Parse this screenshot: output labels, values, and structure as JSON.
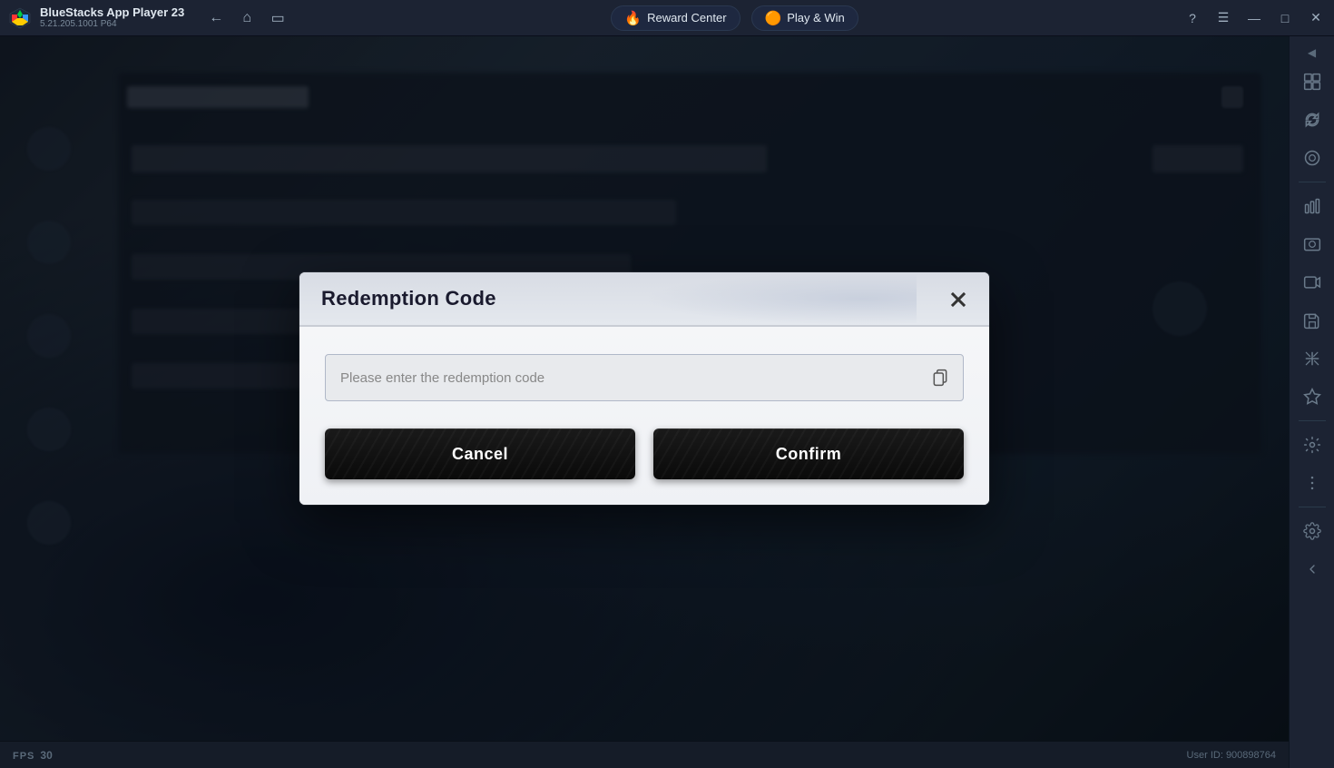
{
  "titlebar": {
    "app_name": "BlueStacks App Player 23",
    "app_version": "5.21.205.1001 P64",
    "reward_center_label": "Reward Center",
    "play_win_label": "Play & Win"
  },
  "window_controls": {
    "help": "?",
    "menu": "≡",
    "minimize": "—",
    "maximize": "□",
    "close": "✕"
  },
  "modal": {
    "title": "Redemption Code",
    "input_placeholder": "Please enter the redemption code",
    "cancel_label": "Cancel",
    "confirm_label": "Confirm"
  },
  "statusbar": {
    "fps_label": "FPS",
    "fps_value": "30",
    "user_id_label": "User ID: 900898764"
  },
  "sidebar_icons": {
    "arrow_left": "◀",
    "arrow_expand": "▶",
    "icons": [
      "⬛",
      "⊞",
      "↺",
      "⊙",
      "🏅",
      "📷",
      "📹",
      "💾",
      "↔",
      "★",
      "⚙",
      "…",
      "⚙",
      "◀"
    ]
  }
}
